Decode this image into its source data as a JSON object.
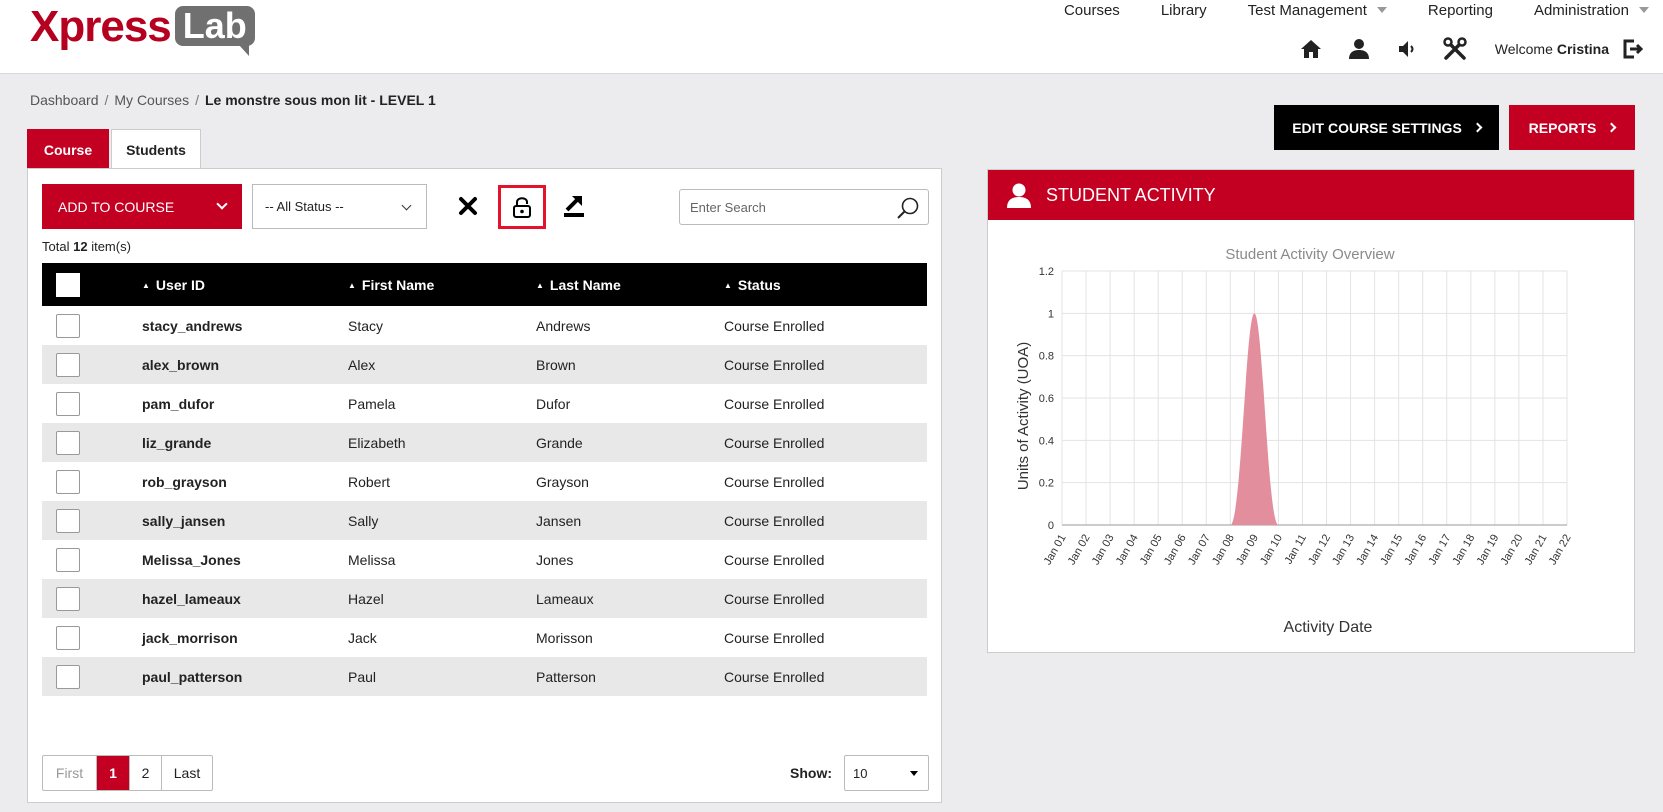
{
  "logo": {
    "part1": "Xpress",
    "part2": "Lab"
  },
  "nav": {
    "items": [
      {
        "label": "Courses",
        "dropdown": false
      },
      {
        "label": "Library",
        "dropdown": false
      },
      {
        "label": "Test Management",
        "dropdown": true
      },
      {
        "label": "Reporting",
        "dropdown": false
      },
      {
        "label": "Administration",
        "dropdown": true
      }
    ]
  },
  "user": {
    "welcome": "Welcome",
    "name": "Cristina"
  },
  "breadcrumb": {
    "items": [
      "Dashboard",
      "My Courses"
    ],
    "current": "Le monstre sous mon lit - LEVEL 1"
  },
  "actions": {
    "edit": "EDIT COURSE SETTINGS",
    "reports": "REPORTS"
  },
  "tabs": {
    "course": "Course",
    "students": "Students"
  },
  "toolbar": {
    "add": "ADD TO COURSE",
    "status": "-- All Status --",
    "search_placeholder": "Enter Search"
  },
  "total": {
    "prefix": "Total",
    "count": "12",
    "suffix": "item(s)"
  },
  "table": {
    "headers": {
      "uid": "User ID",
      "first": "First Name",
      "last": "Last Name",
      "status": "Status"
    },
    "rows": [
      {
        "uid": "stacy_andrews",
        "first": "Stacy",
        "last": "Andrews",
        "status": "Course Enrolled"
      },
      {
        "uid": "alex_brown",
        "first": "Alex",
        "last": "Brown",
        "status": "Course Enrolled"
      },
      {
        "uid": "pam_dufor",
        "first": "Pamela",
        "last": "Dufor",
        "status": "Course Enrolled"
      },
      {
        "uid": "liz_grande",
        "first": "Elizabeth",
        "last": "Grande",
        "status": "Course Enrolled"
      },
      {
        "uid": "rob_grayson",
        "first": "Robert",
        "last": "Grayson",
        "status": "Course Enrolled"
      },
      {
        "uid": "sally_jansen",
        "first": "Sally",
        "last": "Jansen",
        "status": "Course Enrolled"
      },
      {
        "uid": "Melissa_Jones",
        "first": "Melissa",
        "last": "Jones",
        "status": "Course Enrolled"
      },
      {
        "uid": "hazel_lameaux",
        "first": "Hazel",
        "last": "Lameaux",
        "status": "Course Enrolled"
      },
      {
        "uid": "jack_morrison",
        "first": "Jack",
        "last": "Morisson",
        "status": "Course Enrolled"
      },
      {
        "uid": "paul_patterson",
        "first": "Paul",
        "last": "Patterson",
        "status": "Course Enrolled"
      }
    ]
  },
  "pager": {
    "first": "First",
    "p1": "1",
    "p2": "2",
    "last": "Last",
    "show_label": "Show:",
    "show_value": "10"
  },
  "activity": {
    "title": "STUDENT ACTIVITY"
  },
  "colors": {
    "brand": "#c30022",
    "area": "#e38e9c"
  },
  "chart_data": {
    "type": "area",
    "title": "Student Activity Overview",
    "xlabel": "Activity Date",
    "ylabel": "Units of Activity (UOA)",
    "categories": [
      "Jan 01",
      "Jan 02",
      "Jan 03",
      "Jan 04",
      "Jan 05",
      "Jan 06",
      "Jan 07",
      "Jan 08",
      "Jan 09",
      "Jan 10",
      "Jan 11",
      "Jan 12",
      "Jan 13",
      "Jan 14",
      "Jan 15",
      "Jan 16",
      "Jan 17",
      "Jan 18",
      "Jan 19",
      "Jan 20",
      "Jan 21",
      "Jan 22"
    ],
    "values": [
      0,
      0,
      0,
      0,
      0,
      0,
      0,
      0,
      1,
      0,
      0,
      0,
      0,
      0,
      0,
      0,
      0,
      0,
      0,
      0,
      0,
      0
    ],
    "ylim": [
      0,
      1.2
    ],
    "yticks": [
      "0",
      "0.2",
      "0.4",
      "0.6",
      "0.8",
      "1",
      "1.2"
    ],
    "grid": true
  }
}
